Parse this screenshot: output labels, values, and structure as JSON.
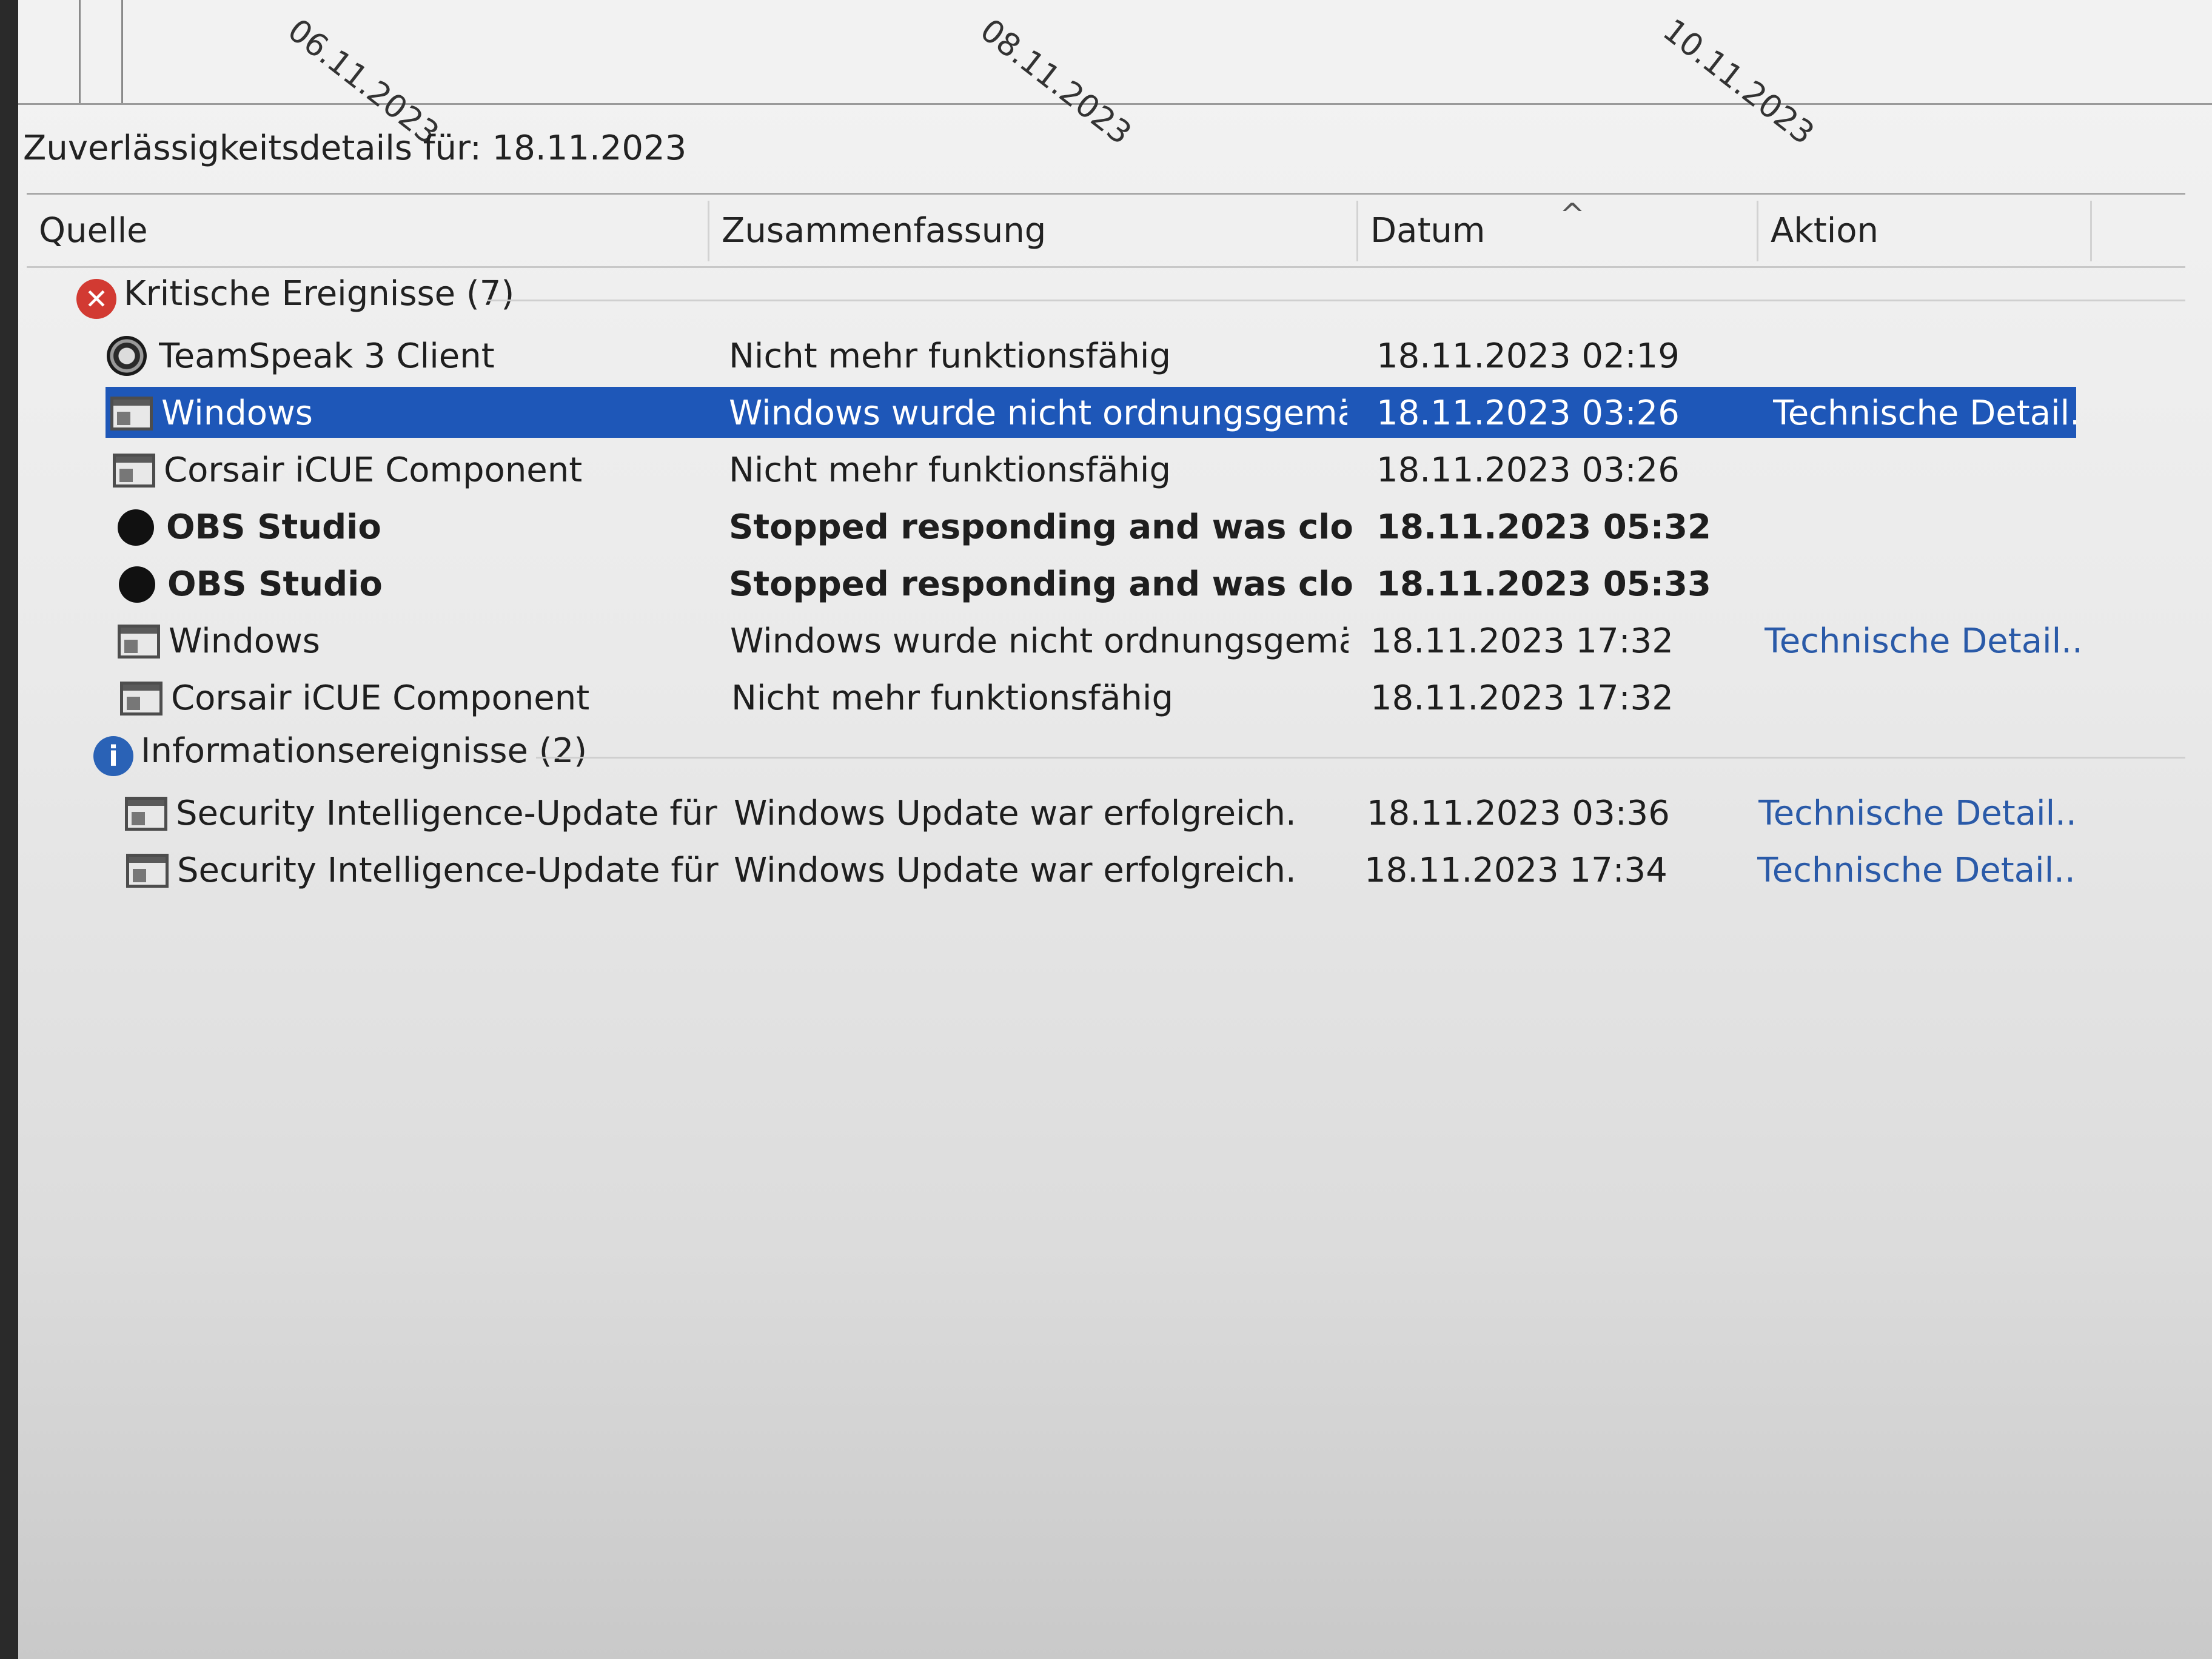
{
  "chart": {
    "date_labels": [
      "06.11.2023",
      "08.11.2023",
      "10.11.2023"
    ]
  },
  "details": {
    "title": "Zuverlässigkeitsdetails für: 18.11.2023"
  },
  "columns": {
    "source": "Quelle",
    "summary": "Zusammenfassung",
    "date": "Datum",
    "sort_indicator": "^",
    "action": "Aktion"
  },
  "groups": [
    {
      "label": "Kritische Ereignisse (7)",
      "icon": "error-icon",
      "icon_glyph": "✕",
      "color": "#d23a32",
      "rows": [
        {
          "source": "TeamSpeak 3 Client",
          "summary": "Nicht mehr funktionsfähig",
          "date": "18.11.2023 02:19",
          "action": ""
        },
        {
          "source": "Windows",
          "summary": "Windows wurde nicht ordnungsgemäß ...",
          "date": "18.11.2023 03:26",
          "action": "Technische Detail..."
        },
        {
          "source": "Corsair iCUE Component",
          "summary": "Nicht mehr funktionsfähig",
          "date": "18.11.2023 03:26",
          "action": ""
        },
        {
          "source": "OBS Studio",
          "summary": "Stopped responding and was closed",
          "date": "18.11.2023 05:32",
          "action": ""
        },
        {
          "source": "OBS Studio",
          "summary": "Stopped responding and was closed",
          "date": "18.11.2023 05:33",
          "action": ""
        },
        {
          "source": "Windows",
          "summary": "Windows wurde nicht ordnungsgemäß ...",
          "date": "18.11.2023 17:32",
          "action": "Technische Detail..."
        },
        {
          "source": "Corsair iCUE Component",
          "summary": "Nicht mehr funktionsfähig",
          "date": "18.11.2023 17:32",
          "action": ""
        }
      ]
    },
    {
      "label": "Informationsereignisse (2)",
      "icon": "info-icon",
      "icon_glyph": "i",
      "color": "#2a62b6",
      "rows": [
        {
          "source": "Security Intelligence-Update für M...",
          "summary": "Windows Update war erfolgreich.",
          "date": "18.11.2023 03:36",
          "action": "Technische Detail..."
        },
        {
          "source": "Security Intelligence-Update für M...",
          "summary": "Windows Update war erfolgreich.",
          "date": "18.11.2023 17:34",
          "action": "Technische Detail..."
        }
      ]
    }
  ],
  "selection_color": "#1e57b8"
}
